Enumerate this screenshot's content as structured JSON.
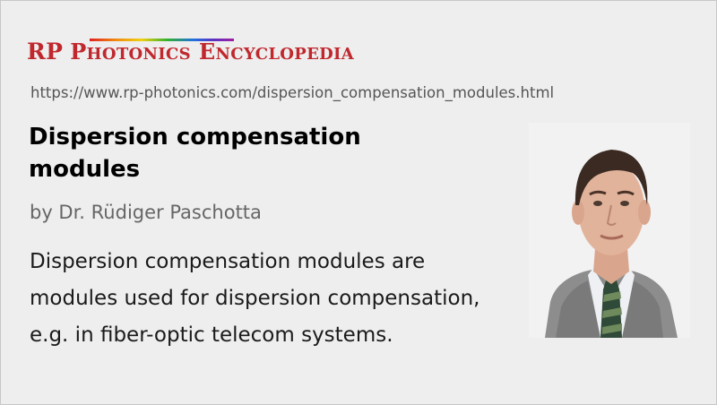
{
  "logo": {
    "rp": "RP",
    "p_big": "P",
    "p_small": "HOTONICS",
    "e_big": "E",
    "e_small": "NCYCLOPEDIA"
  },
  "url": "https://www.rp-photonics.com/dispersion_compensation_modules.html",
  "title": "Dispersion compensation modules",
  "author": "by Dr. Rüdiger Paschotta",
  "description": "Dispersion compensation modules are modules used for dispersion compensation, e.g. in fiber-optic telecom systems.",
  "colors": {
    "brand_red": "#c0282d",
    "background": "#eeeeee",
    "url_gray": "#555555",
    "author_gray": "#666666"
  }
}
